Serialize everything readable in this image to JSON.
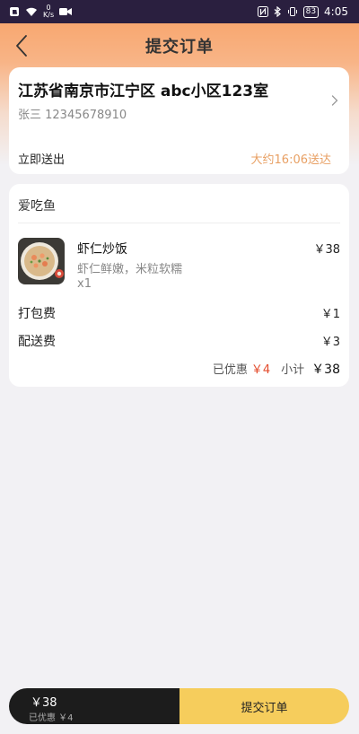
{
  "status_bar": {
    "speed_value": "0",
    "speed_unit": "K/s",
    "battery": "83",
    "time": "4:05"
  },
  "nav": {
    "title": "提交订单"
  },
  "address": {
    "line": "江苏省南京市江宁区 abc小区123室",
    "contact": "张三 12345678910",
    "delivery_label": "立即送出",
    "delivery_time": "大约16:06送达"
  },
  "order": {
    "shop_name": "爱吃鱼",
    "items": [
      {
        "name": "虾仁炒饭",
        "desc": "虾仁鲜嫩，米粒软糯",
        "qty": "x1",
        "price": "￥38"
      }
    ],
    "packing_fee_label": "打包费",
    "packing_fee": "￥1",
    "delivery_fee_label": "配送费",
    "delivery_fee": "￥3",
    "discount_label": "已优惠",
    "discount": "￥4",
    "subtotal_label": "小计",
    "subtotal": "￥38"
  },
  "bottom": {
    "total": "￥38",
    "discount_text": "已优惠 ￥4",
    "submit_label": "提交订单"
  },
  "colors": {
    "accent_orange": "#e8a064",
    "discount_red": "#e34b2c",
    "submit_yellow": "#f6cd5c",
    "status_bar": "#2a1f3f"
  }
}
